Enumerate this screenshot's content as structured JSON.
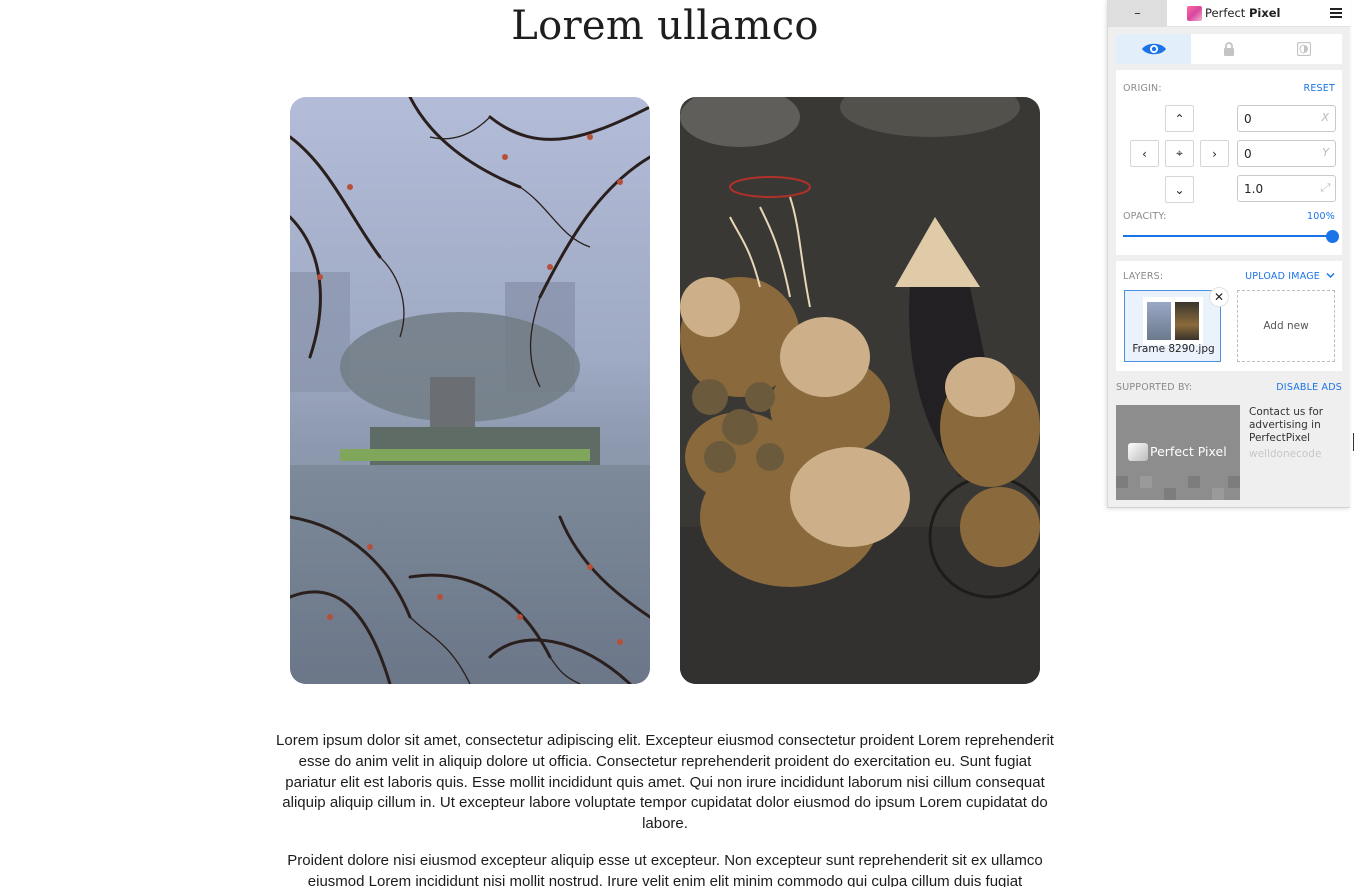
{
  "page": {
    "title": "Lorem ullamco",
    "paragraphs": [
      "Lorem ipsum dolor sit amet, consectetur adipiscing elit. Excepteur eiusmod consectetur proident Lorem reprehenderit esse do anim velit in aliquip dolore ut officia. Consectetur reprehenderit proident do exercitation eu. Sunt fugiat pariatur elit est laboris quis. Esse mollit incididunt quis amet. Qui non irure incididunt laborum nisi cillum consequat aliquip aliquip cillum in. Ut excepteur labore voluptate tempor cupidatat dolor eiusmod do ipsum Lorem cupidatat do labore.",
      "Proident dolore nisi eiusmod excepteur aliquip esse ut excepteur. Non excepteur sunt reprehenderit sit ex ullamco eiusmod Lorem incididunt nisi mollit nostrud. Irure velit enim elit minim commodo qui culpa cillum duis fugiat"
    ]
  },
  "perfect_pixel": {
    "minimize_label": "–",
    "brand_regular": "Perfect ",
    "brand_bold": "Pixel",
    "origin_label": "ORIGIN:",
    "reset_label": "RESET",
    "arrows": {
      "up": "⌃",
      "down": "⌄",
      "left": "‹",
      "right": "›",
      "center": "⌖"
    },
    "fields": {
      "x": {
        "value": "0",
        "suffix": "X"
      },
      "y": {
        "value": "0",
        "suffix": "Y"
      },
      "scale": {
        "value": "1.0",
        "suffix": "⤢"
      }
    },
    "opacity_label": "OPACITY:",
    "opacity_value_text": "100%",
    "opacity": 1.0,
    "layers_label": "LAYERS:",
    "upload_label": "UPLOAD IMAGE",
    "layer_name": "Frame 8290.jpg",
    "layer_close": "✕",
    "add_new_label": "Add new",
    "supported_label": "SUPPORTED BY:",
    "disable_ads_label": "DISABLE ADS",
    "ad_logo_text": "Perfect Pixel",
    "ad_text": "Contact us for advertising in PerfectPixel",
    "ad_sub": "welldonecode",
    "accent_color": "#1a73e8"
  }
}
